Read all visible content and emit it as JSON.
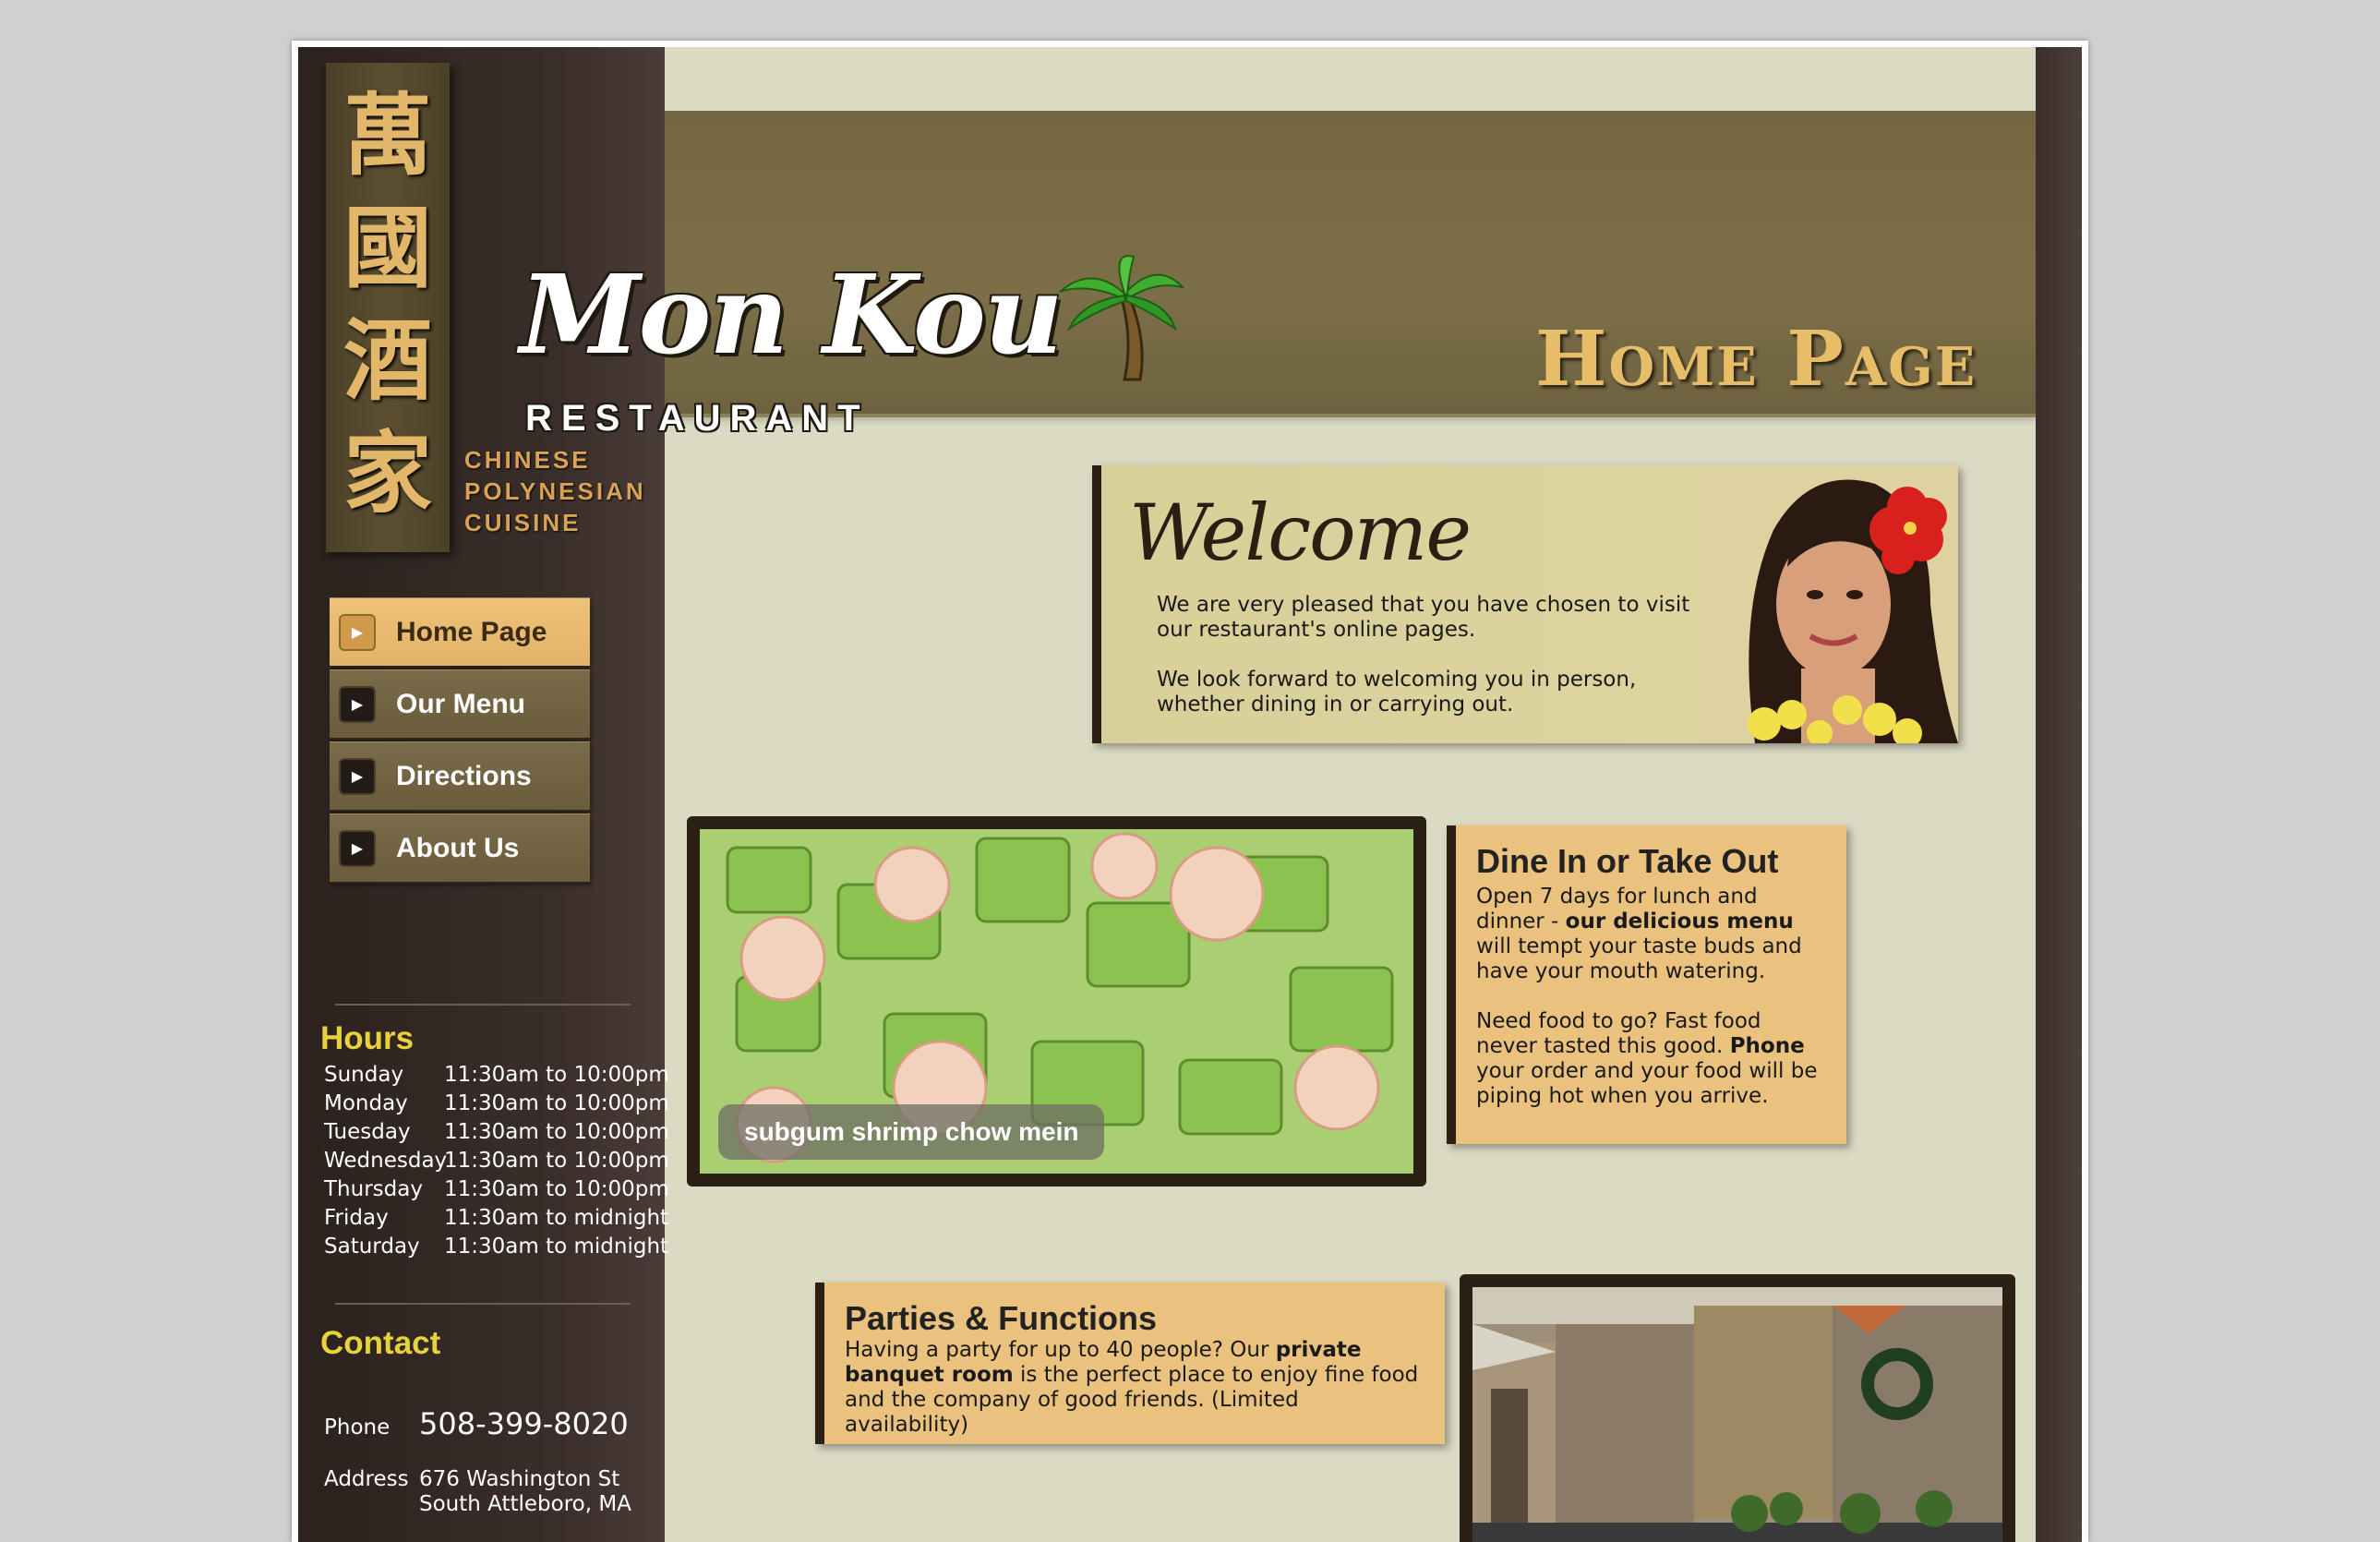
{
  "header": {
    "chinese_characters": [
      "萬",
      "國",
      "酒",
      "家"
    ],
    "cuisine_lines": [
      "CHINESE",
      "POLYNESIAN",
      "CUISINE"
    ],
    "logo_title": "Mon Kou",
    "logo_subtitle": "RESTAURANT",
    "page_title": "Home Page"
  },
  "nav": {
    "items": [
      {
        "label": "Home Page",
        "active": true
      },
      {
        "label": "Our Menu",
        "active": false
      },
      {
        "label": "Directions",
        "active": false
      },
      {
        "label": "About Us",
        "active": false
      }
    ]
  },
  "hours": {
    "heading": "Hours",
    "rows": [
      {
        "day": "Sunday",
        "time": "11:30am to 10:00pm"
      },
      {
        "day": "Monday",
        "time": "11:30am to 10:00pm"
      },
      {
        "day": "Tuesday",
        "time": "11:30am to 10:00pm"
      },
      {
        "day": "Wednesday",
        "time": "11:30am to 10:00pm"
      },
      {
        "day": "Thursday",
        "time": "11:30am to 10:00pm"
      },
      {
        "day": "Friday",
        "time": "11:30am to midnight"
      },
      {
        "day": "Saturday",
        "time": "11:30am to midnight"
      }
    ]
  },
  "contact": {
    "heading": "Contact",
    "phone_label": "Phone",
    "phone": "508-399-8020",
    "address_label": "Address",
    "address_line1": "676 Washington St",
    "address_line2": "South Attleboro, MA"
  },
  "welcome": {
    "title": "Welcome",
    "para1": "We are very pleased that you have chosen to visit our restaurant's online pages.",
    "para2": "We look forward to welcoming you in person, whether dining in or carrying out."
  },
  "food_photo": {
    "caption": "subgum shrimp chow mein"
  },
  "dine": {
    "heading": "Dine In or Take Out",
    "p1_before": "Open 7 days for lunch and dinner - ",
    "p1_bold": "our delicious menu",
    "p1_after": " will tempt your taste buds and have your mouth watering.",
    "p2_before": "Need food to go? Fast food never tasted this good. ",
    "p2_bold": "Phone",
    "p2_after": " your order and your food will be piping hot when you arrive."
  },
  "parties": {
    "heading": "Parties & Functions",
    "before": "Having a party for up to 40 people? Our ",
    "bold": "private banquet room",
    "after": " is the perfect place to enjoy fine food and the company of good friends. (Limited availability)"
  },
  "colors": {
    "accent_gold": "#e7bd68",
    "header_olive": "#7c6f48",
    "box_tan": "#eac27e",
    "hours_heading": "#e8d23a"
  }
}
